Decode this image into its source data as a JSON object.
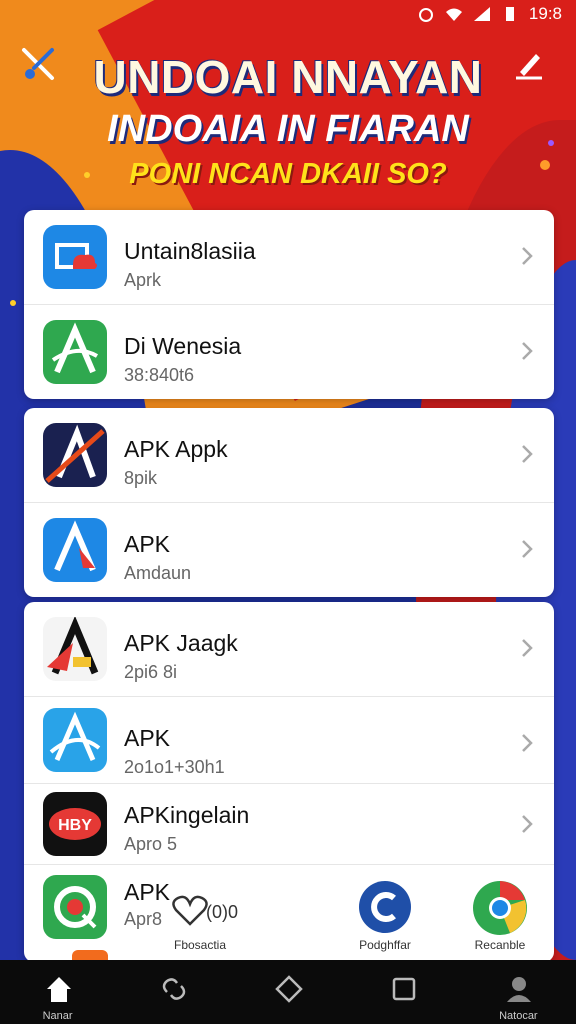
{
  "status": {
    "time": "19:8"
  },
  "header": {
    "title": "UNDOAI NNAYAN",
    "subtitle": "INDOAIA IN FIARAN",
    "tagline": "PONI NCAN DKAII SO?"
  },
  "apps": [
    {
      "title": "Untain8lasiia",
      "subtitle": "Aprk",
      "icon": "cloud-app-icon"
    },
    {
      "title": "Di Wenesia",
      "subtitle": "38:840t6",
      "icon": "green-a-app-icon"
    },
    {
      "title": "APK Appk",
      "subtitle": "8pik",
      "icon": "navy-a-app-icon"
    },
    {
      "title": "APK",
      "subtitle": "Amdaun",
      "icon": "blue-a-app-icon"
    },
    {
      "title": "APK Jaagk",
      "subtitle": "2pi6 8i",
      "icon": "red-a-app-icon"
    },
    {
      "title": "APK",
      "subtitle": "2o1o1+30h1",
      "icon": "sky-a-app-icon"
    },
    {
      "title": "APKingelain",
      "subtitle": "Apro 5",
      "icon": "hby-app-icon"
    },
    {
      "title": "APK",
      "subtitle": "Apr8",
      "icon": "green-target-app-icon"
    }
  ],
  "overlay_apps": [
    {
      "label": "Fbosactia",
      "value": "(0)0",
      "icon": "heart-outline-icon"
    },
    {
      "label": "Podghffar",
      "icon": "blue-c-app-icon"
    },
    {
      "label": "Recanble",
      "icon": "chrome-like-icon"
    }
  ],
  "nav": [
    {
      "label": "Nanar",
      "icon": "home-icon"
    },
    {
      "label": "",
      "icon": "link-icon"
    },
    {
      "label": "",
      "icon": "home-diamond-icon"
    },
    {
      "label": "",
      "icon": "square-icon"
    },
    {
      "label": "Natocar",
      "icon": "person-icon"
    }
  ],
  "colors": {
    "orange": "#f08a1c",
    "red": "#d91f1a",
    "blue": "#1d2f9a",
    "yellow": "#ffe21a"
  }
}
